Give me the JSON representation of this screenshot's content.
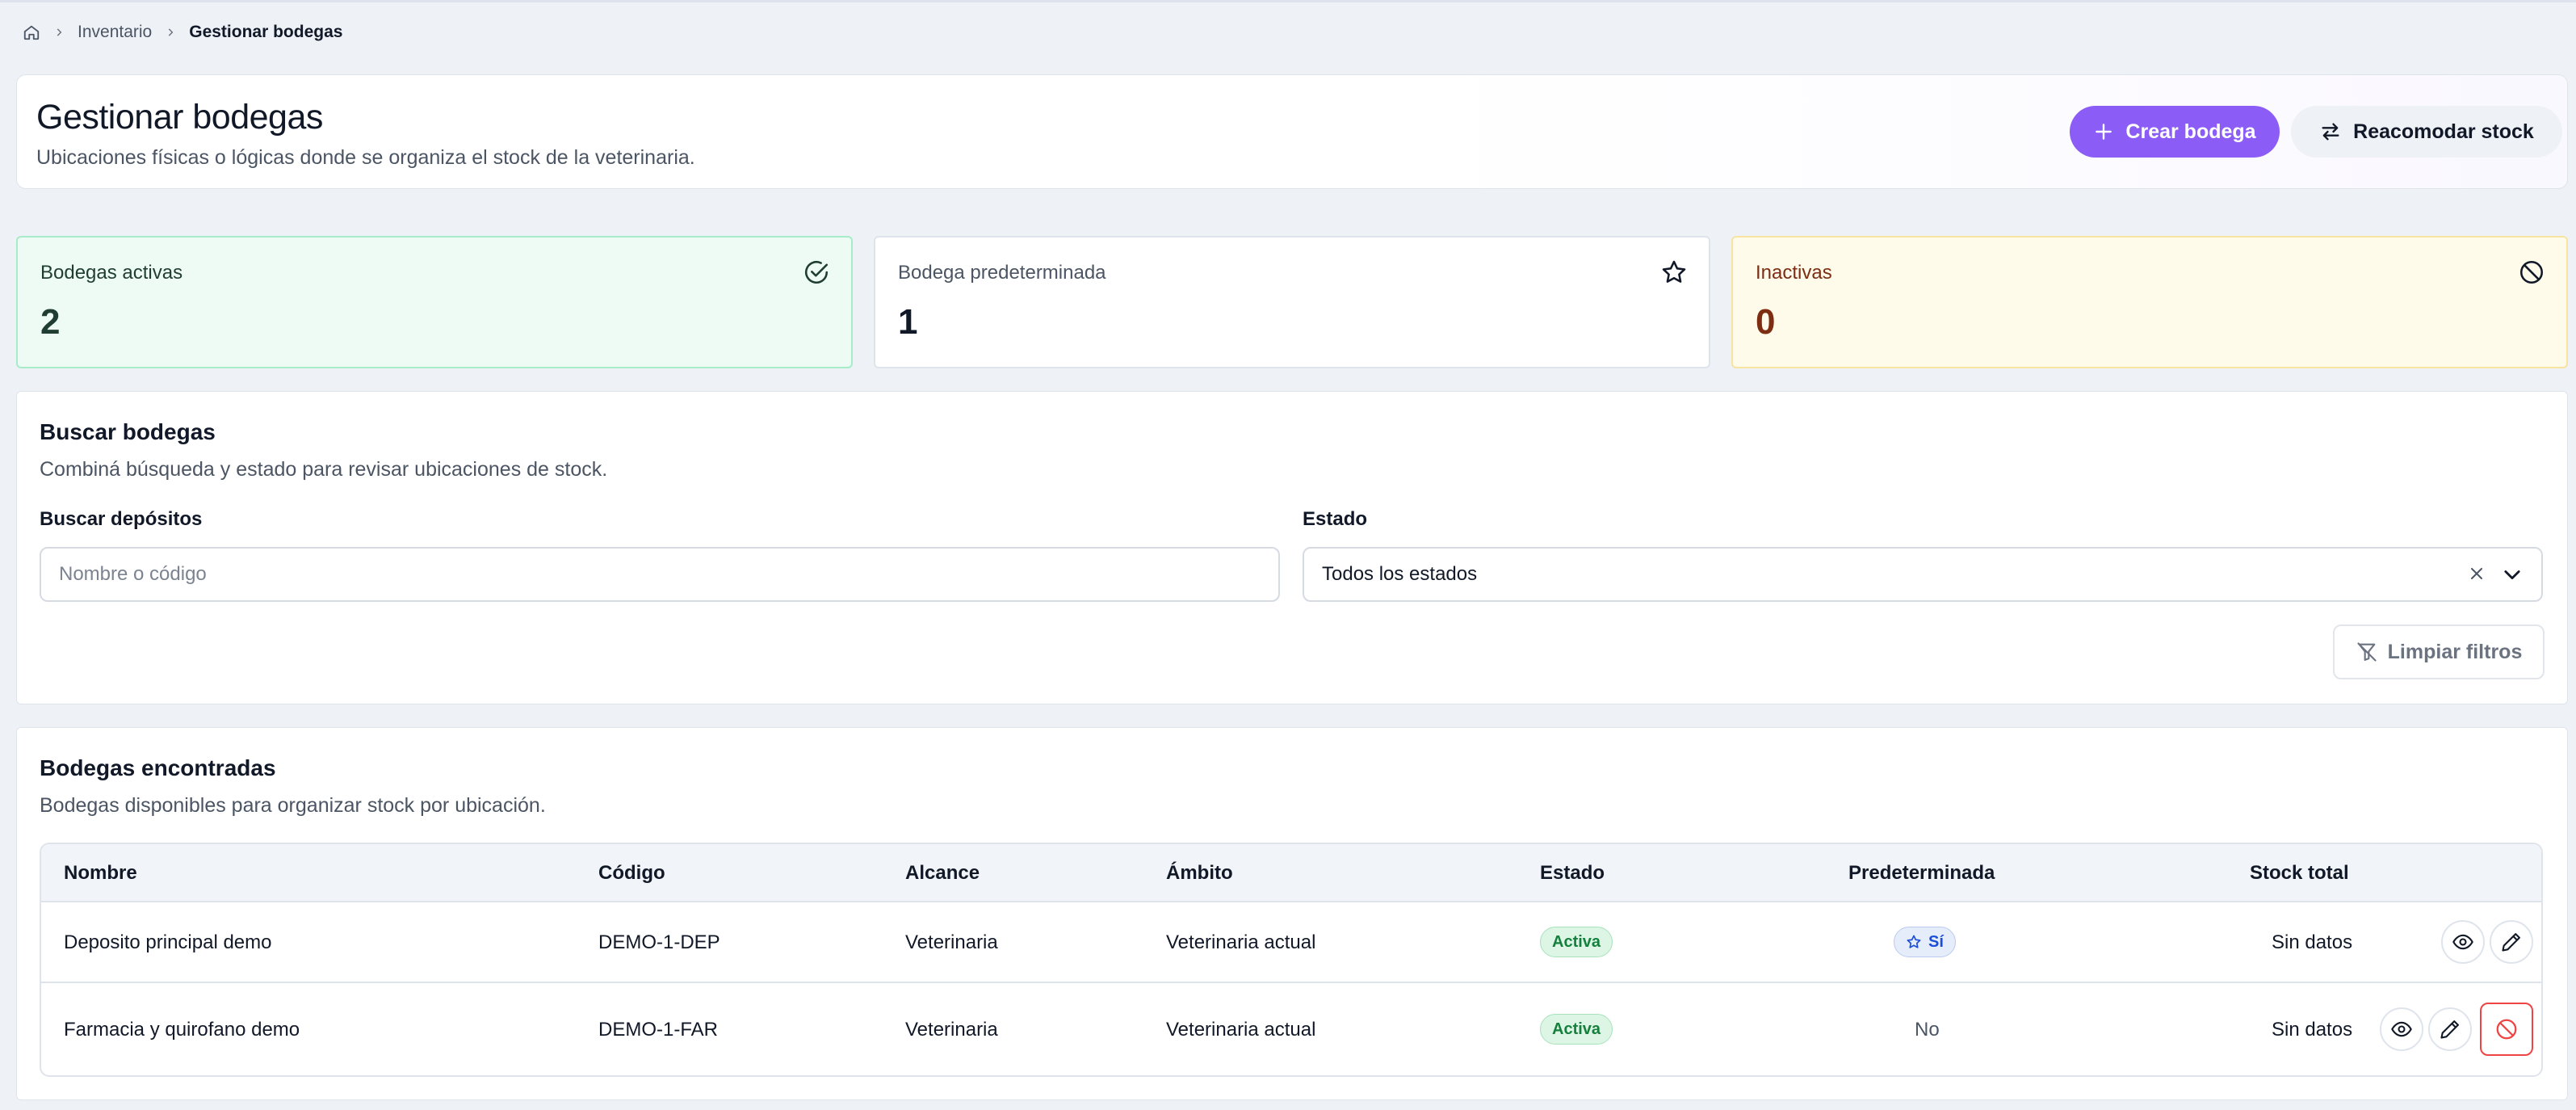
{
  "breadcrumb": {
    "home_icon": "home-icon",
    "items": [
      "Inventario",
      "Gestionar bodegas"
    ]
  },
  "header": {
    "title": "Gestionar bodegas",
    "subtitle": "Ubicaciones físicas o lógicas donde se organiza el stock de la veterinaria.",
    "create_label": "Crear bodega",
    "restock_label": "Reacomodar stock"
  },
  "stats": [
    {
      "label": "Bodegas activas",
      "value": "2",
      "icon": "check-circle-icon"
    },
    {
      "label": "Bodega predeterminada",
      "value": "1",
      "icon": "star-icon"
    },
    {
      "label": "Inactivas",
      "value": "0",
      "icon": "ban-icon"
    }
  ],
  "search": {
    "title": "Buscar bodegas",
    "subtitle": "Combiná búsqueda y estado para revisar ubicaciones de stock.",
    "input_label": "Buscar depósitos",
    "input_value": "",
    "input_placeholder": "Nombre o código",
    "status_label": "Estado",
    "status_value": "Todos los estados",
    "clear_label": "Limpiar filtros"
  },
  "results": {
    "title": "Bodegas encontradas",
    "subtitle": "Bodegas disponibles para organizar stock por ubicación.",
    "columns": [
      "Nombre",
      "Código",
      "Alcance",
      "Ámbito",
      "Estado",
      "Predeterminada",
      "Stock total"
    ],
    "rows": [
      {
        "name": "Deposito principal demo",
        "code": "DEMO-1-DEP",
        "scope": "Veterinaria",
        "ambit": "Veterinaria actual",
        "status": "Activa",
        "default": "Sí",
        "stock": "Sin datos"
      },
      {
        "name": "Farmacia y quirofano demo",
        "code": "DEMO-1-FAR",
        "scope": "Veterinaria",
        "ambit": "Veterinaria actual",
        "status": "Activa",
        "default": "No",
        "stock": "Sin datos"
      }
    ]
  },
  "colors": {
    "accent": "#8b5cf6",
    "active_badge": "#15803d",
    "default_badge": "#1d4ed8",
    "danger": "#ef4444"
  }
}
